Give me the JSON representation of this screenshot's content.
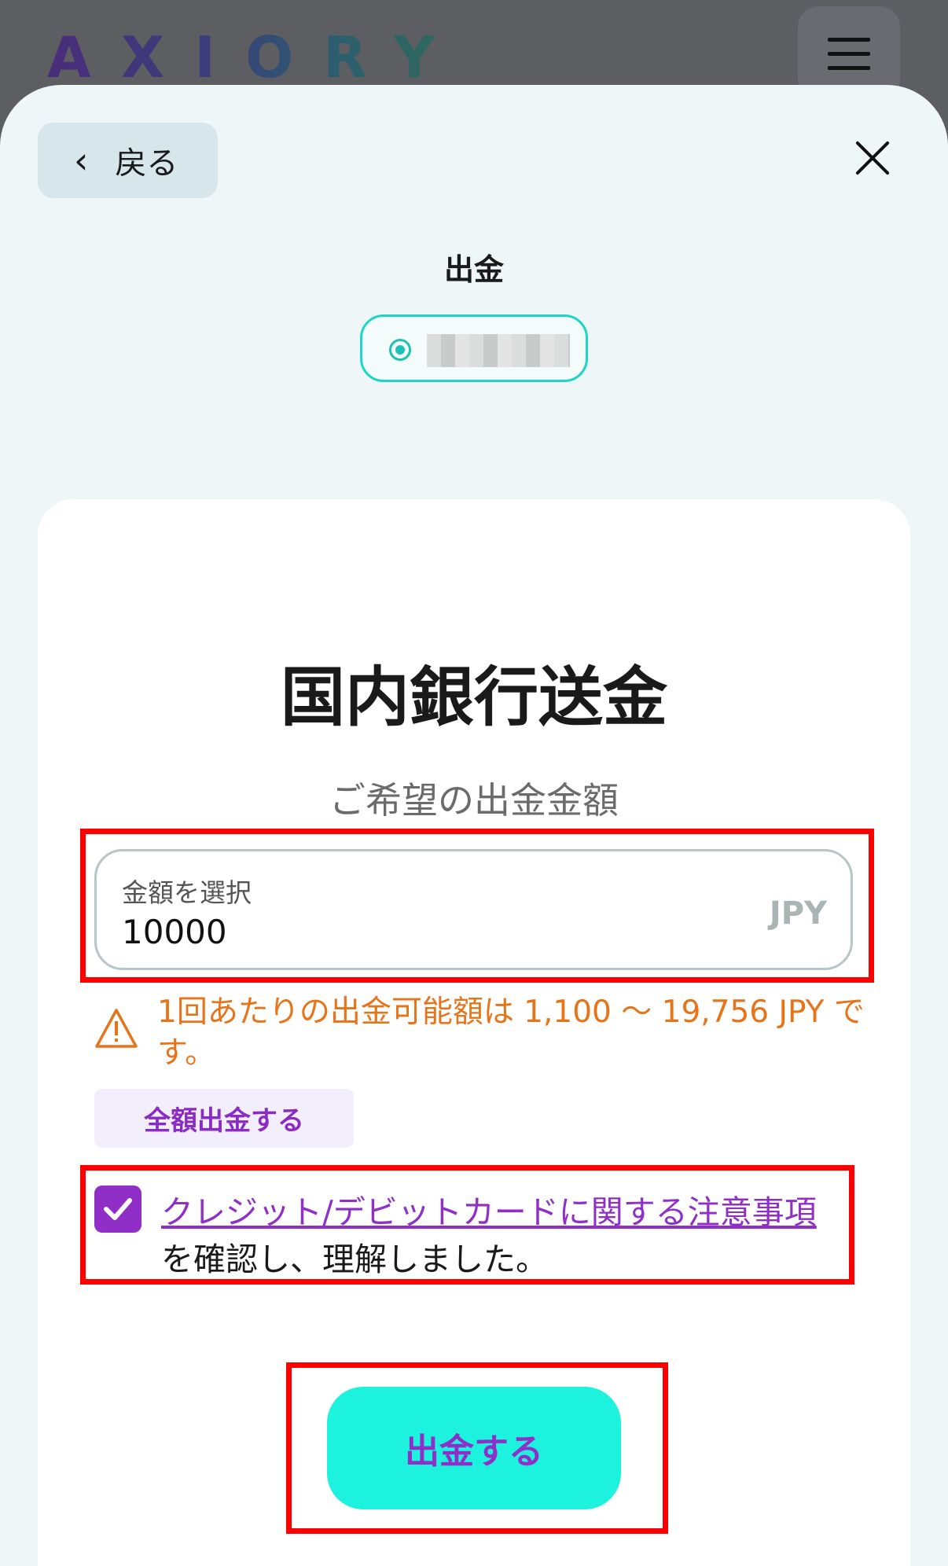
{
  "header": {
    "logo_text": "AXIORY",
    "menu_icon": "hamburger-menu-icon"
  },
  "modal": {
    "back_label": "戻る",
    "section_title": "出金",
    "account_selector": {
      "selected": true,
      "account_name_redacted": true
    }
  },
  "form": {
    "title": "国内銀行送金",
    "subtitle": "ご希望の出金金額",
    "amount_field": {
      "label": "金額を選択",
      "value": "10000",
      "currency": "JPY"
    },
    "warning_text": "1回あたりの出金可能額は 1,100 〜 19,756 JPY です。",
    "full_amount_button": "全額出金する",
    "terms": {
      "checked": true,
      "link_text": "クレジット/デビットカードに関する注意事項",
      "rest_text": "を確認し、理解しました。"
    },
    "submit_label": "出金する"
  },
  "colors": {
    "accent_teal": "#1cf2de",
    "accent_purple": "#8f2fc8",
    "warning_orange": "#e8741a",
    "highlight_red": "#ff0000"
  }
}
